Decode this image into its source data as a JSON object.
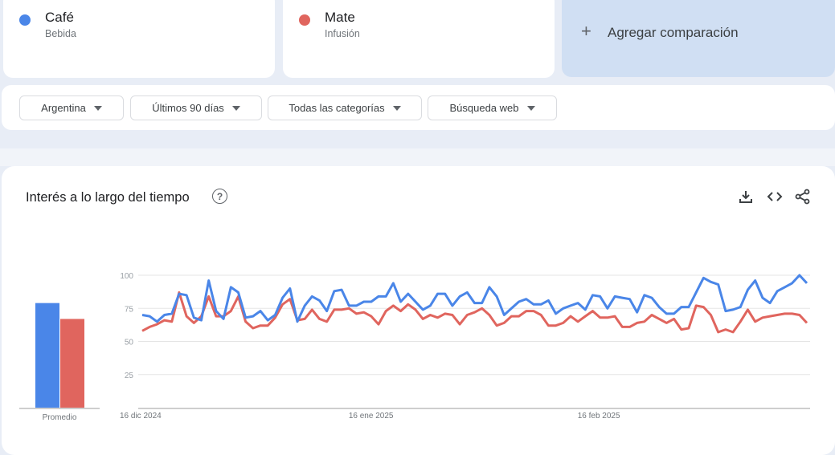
{
  "terms": [
    {
      "name": "Café",
      "category": "Bebida",
      "color": "#4a86e8"
    },
    {
      "name": "Mate",
      "category": "Infusión",
      "color": "#e0655e"
    }
  ],
  "add_comparison": {
    "icon": "plus-icon",
    "label": "Agregar comparación"
  },
  "filters": [
    {
      "label": "Argentina",
      "icon": "caret-down-icon"
    },
    {
      "label": "Últimos 90 días",
      "icon": "caret-down-icon"
    },
    {
      "label": "Todas las categorías",
      "icon": "caret-down-icon"
    },
    {
      "label": "Búsqueda web",
      "icon": "caret-down-icon"
    }
  ],
  "section": {
    "title": "Interés a lo largo del tiempo",
    "help_icon": "help-icon",
    "tools": [
      "download-icon",
      "embed-code-icon",
      "share-icon"
    ]
  },
  "chart_data": [
    {
      "type": "bar",
      "title": "",
      "categories": [
        "Promedio"
      ],
      "series": [
        {
          "name": "Café",
          "values": [
            79
          ],
          "color": "#4a86e8"
        },
        {
          "name": "Mate",
          "values": [
            67
          ],
          "color": "#e0655e"
        }
      ],
      "xlabel": "Promedio",
      "ylim": [
        0,
        100
      ]
    },
    {
      "type": "line",
      "title": "Interés a lo largo del tiempo",
      "x_tick_labels": [
        {
          "label": "16 dic 2024",
          "index": 0
        },
        {
          "label": "16 ene 2025",
          "index": 31
        },
        {
          "label": "16 feb 2025",
          "index": 62
        }
      ],
      "y_ticks": [
        25,
        50,
        75,
        100
      ],
      "ylim": [
        0,
        100
      ],
      "grid": true,
      "series": [
        {
          "name": "Café",
          "color": "#4a86e8",
          "values": [
            70,
            69,
            65,
            70,
            71,
            86,
            85,
            68,
            66,
            96,
            73,
            67,
            91,
            87,
            68,
            69,
            73,
            66,
            70,
            83,
            90,
            65,
            77,
            84,
            81,
            73,
            88,
            89,
            77,
            77,
            80,
            80,
            84,
            84,
            94,
            80,
            86,
            80,
            74,
            77,
            86,
            86,
            77,
            84,
            87,
            79,
            79,
            91,
            84,
            70,
            75,
            80,
            82,
            78,
            78,
            81,
            71,
            75,
            77,
            79,
            74,
            85,
            84,
            75,
            84,
            83,
            82,
            72,
            85,
            83,
            76,
            71,
            71,
            76,
            76,
            87,
            98,
            95,
            93,
            73,
            74,
            76,
            89,
            96,
            83,
            79,
            88,
            91,
            94,
            100,
            94
          ],
          "avg": 79
        },
        {
          "name": "Mate",
          "color": "#e0655e",
          "values": [
            58,
            61,
            63,
            66,
            65,
            87,
            69,
            64,
            69,
            84,
            69,
            69,
            73,
            84,
            65,
            60,
            62,
            62,
            68,
            78,
            82,
            66,
            67,
            74,
            67,
            65,
            74,
            74,
            75,
            71,
            72,
            69,
            63,
            73,
            77,
            73,
            78,
            74,
            67,
            70,
            68,
            71,
            70,
            63,
            70,
            72,
            75,
            70,
            62,
            64,
            69,
            69,
            73,
            73,
            70,
            62,
            62,
            64,
            69,
            65,
            69,
            73,
            68,
            68,
            69,
            61,
            61,
            64,
            65,
            70,
            67,
            64,
            67,
            59,
            60,
            77,
            76,
            70,
            57,
            59,
            57,
            65,
            74,
            65,
            68,
            69,
            70,
            71,
            71,
            70,
            64
          ],
          "avg": 67
        }
      ],
      "legend": "top"
    }
  ]
}
